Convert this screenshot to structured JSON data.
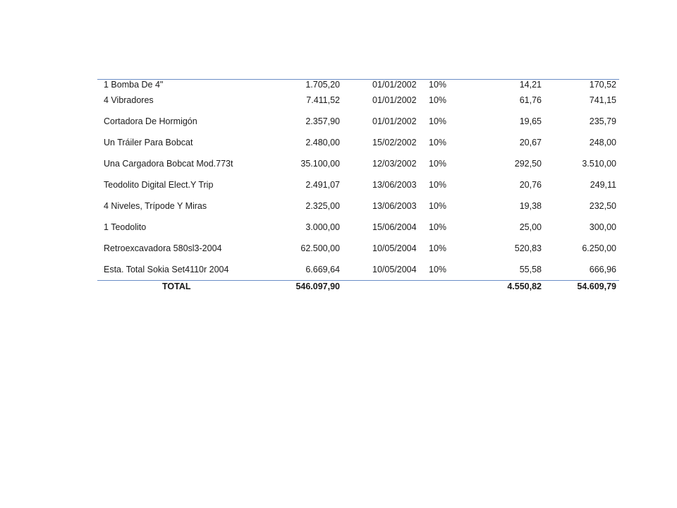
{
  "table": {
    "rows": [
      {
        "name": "1 Bomba De 4\"",
        "cost": "1.705,20",
        "date": "01/01/2002",
        "rate": "10%",
        "monthly": "14,21",
        "annual": "170,52"
      },
      {
        "name": "4 Vibradores",
        "cost": "7.411,52",
        "date": "01/01/2002",
        "rate": "10%",
        "monthly": "61,76",
        "annual": "741,15"
      },
      {
        "name": "Cortadora De Hormigón",
        "cost": "2.357,90",
        "date": "01/01/2002",
        "rate": "10%",
        "monthly": "19,65",
        "annual": "235,79"
      },
      {
        "name": "Un Tráiler Para Bobcat",
        "cost": "2.480,00",
        "date": "15/02/2002",
        "rate": "10%",
        "monthly": "20,67",
        "annual": "248,00"
      },
      {
        "name": "Una Cargadora Bobcat Mod.773t",
        "cost": "35.100,00",
        "date": "12/03/2002",
        "rate": "10%",
        "monthly": "292,50",
        "annual": "3.510,00"
      },
      {
        "name": "Teodolito Digital Elect.Y Trip",
        "cost": "2.491,07",
        "date": "13/06/2003",
        "rate": "10%",
        "monthly": "20,76",
        "annual": "249,11"
      },
      {
        "name": "4 Niveles, Trípode Y Miras",
        "cost": "2.325,00",
        "date": "13/06/2003",
        "rate": "10%",
        "monthly": "19,38",
        "annual": "232,50"
      },
      {
        "name": "1 Teodolito",
        "cost": "3.000,00",
        "date": "15/06/2004",
        "rate": "10%",
        "monthly": "25,00",
        "annual": "300,00"
      },
      {
        "name": "Retroexcavadora 580sl3-2004",
        "cost": "62.500,00",
        "date": "10/05/2004",
        "rate": "10%",
        "monthly": "520,83",
        "annual": "6.250,00"
      },
      {
        "name": "Esta. Total Sokia Set4110r 2004",
        "cost": "6.669,64",
        "date": "10/05/2004",
        "rate": "10%",
        "monthly": "55,58",
        "annual": "666,96"
      }
    ],
    "total": {
      "label": "TOTAL",
      "cost": "546.097,90",
      "monthly": "4.550,82",
      "annual": "54.609,79"
    }
  },
  "colors": {
    "rule": "#6b8ec7",
    "text": "#1a1a1a",
    "background": "#ffffff"
  }
}
